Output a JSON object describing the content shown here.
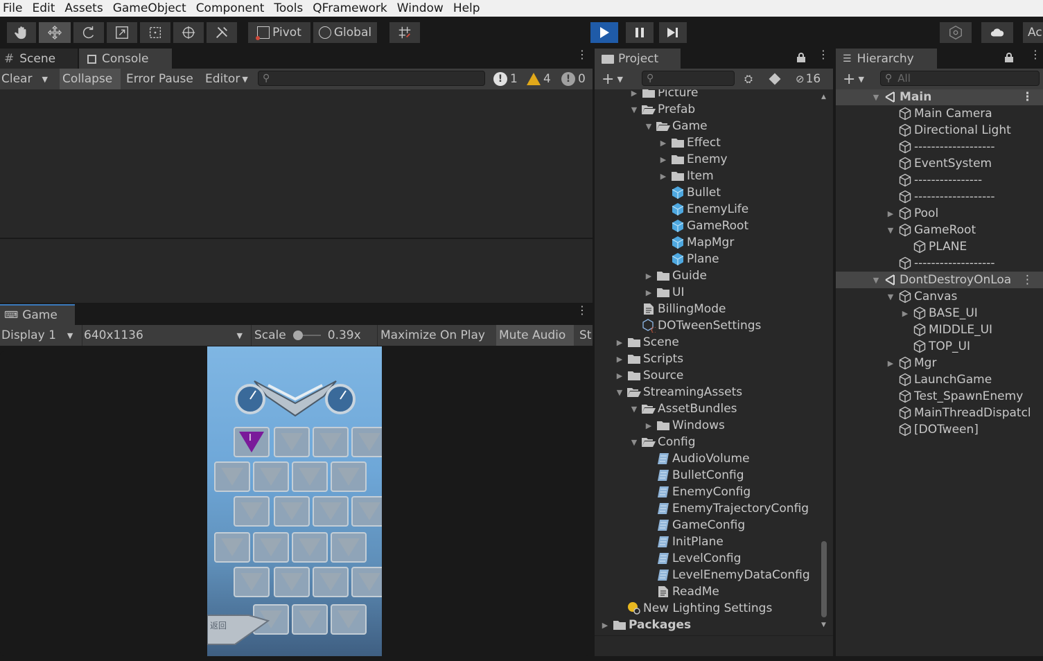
{
  "menu": [
    "File",
    "Edit",
    "Assets",
    "GameObject",
    "Component",
    "Tools",
    "QFramework",
    "Window",
    "Help"
  ],
  "toolbar": {
    "tools": [
      "hand-tool",
      "move-tool",
      "rotate-tool",
      "scale-tool",
      "rect-tool",
      "transform-tool",
      "custom-tool"
    ],
    "pivot_label": "Pivot",
    "global_label": "Global",
    "account_label": "Ac"
  },
  "scene_tab": "Scene",
  "console": {
    "tab": "Console",
    "clear": "Clear",
    "collapse": "Collapse",
    "error_pause": "Error Pause",
    "editor": "Editor",
    "count_error": "1",
    "count_warn": "4",
    "count_info": "0"
  },
  "game": {
    "tab": "Game",
    "display": "Display 1",
    "resolution": "640x1136",
    "scale_label": "Scale",
    "scale_value": "0.39x",
    "maximize": "Maximize On Play",
    "mute": "Mute Audio",
    "stats": "St",
    "back_text": "返回",
    "level_marker": "I"
  },
  "project": {
    "tab": "Project",
    "hidden_count": "16",
    "items": [
      {
        "label": "Picture",
        "indent": 1,
        "arrow": "right",
        "icon": "folder"
      },
      {
        "label": "Prefab",
        "indent": 1,
        "arrow": "down",
        "icon": "folder-open"
      },
      {
        "label": "Game",
        "indent": 2,
        "arrow": "down",
        "icon": "folder-open"
      },
      {
        "label": "Effect",
        "indent": 3,
        "arrow": "right",
        "icon": "folder"
      },
      {
        "label": "Enemy",
        "indent": 3,
        "arrow": "right",
        "icon": "folder"
      },
      {
        "label": "Item",
        "indent": 3,
        "arrow": "right",
        "icon": "folder"
      },
      {
        "label": "Bullet",
        "indent": 3,
        "arrow": "",
        "icon": "prefab"
      },
      {
        "label": "EnemyLife",
        "indent": 3,
        "arrow": "",
        "icon": "prefab"
      },
      {
        "label": "GameRoot",
        "indent": 3,
        "arrow": "",
        "icon": "prefab"
      },
      {
        "label": "MapMgr",
        "indent": 3,
        "arrow": "",
        "icon": "prefab"
      },
      {
        "label": "Plane",
        "indent": 3,
        "arrow": "",
        "icon": "prefab"
      },
      {
        "label": "Guide",
        "indent": 2,
        "arrow": "right",
        "icon": "folder"
      },
      {
        "label": "UI",
        "indent": 2,
        "arrow": "right",
        "icon": "folder"
      },
      {
        "label": "BillingMode",
        "indent": 1,
        "arrow": "",
        "icon": "file"
      },
      {
        "label": "DOTweenSettings",
        "indent": 1,
        "arrow": "",
        "icon": "settings"
      },
      {
        "label": "Scene",
        "indent": 0,
        "arrow": "right",
        "icon": "folder"
      },
      {
        "label": "Scripts",
        "indent": 0,
        "arrow": "right",
        "icon": "folder"
      },
      {
        "label": "Source",
        "indent": 0,
        "arrow": "right",
        "icon": "folder"
      },
      {
        "label": "StreamingAssets",
        "indent": 0,
        "arrow": "down",
        "icon": "folder-open"
      },
      {
        "label": "AssetBundles",
        "indent": 1,
        "arrow": "down",
        "icon": "folder-open"
      },
      {
        "label": "Windows",
        "indent": 2,
        "arrow": "right",
        "icon": "folder"
      },
      {
        "label": "Config",
        "indent": 1,
        "arrow": "down",
        "icon": "folder-open"
      },
      {
        "label": "AudioVolume",
        "indent": 2,
        "arrow": "",
        "icon": "config"
      },
      {
        "label": "BulletConfig",
        "indent": 2,
        "arrow": "",
        "icon": "config"
      },
      {
        "label": "EnemyConfig",
        "indent": 2,
        "arrow": "",
        "icon": "config"
      },
      {
        "label": "EnemyTrajectoryConfig",
        "indent": 2,
        "arrow": "",
        "icon": "config"
      },
      {
        "label": "GameConfig",
        "indent": 2,
        "arrow": "",
        "icon": "config"
      },
      {
        "label": "InitPlane",
        "indent": 2,
        "arrow": "",
        "icon": "config"
      },
      {
        "label": "LevelConfig",
        "indent": 2,
        "arrow": "",
        "icon": "config"
      },
      {
        "label": "LevelEnemyDataConfig",
        "indent": 2,
        "arrow": "",
        "icon": "config"
      },
      {
        "label": "ReadMe",
        "indent": 2,
        "arrow": "",
        "icon": "file"
      },
      {
        "label": "New Lighting Settings",
        "indent": 0,
        "arrow": "",
        "icon": "lighting"
      },
      {
        "label": "Packages",
        "indent": -1,
        "arrow": "right",
        "icon": "folder",
        "bold": true
      }
    ]
  },
  "hierarchy": {
    "tab": "Hierarchy",
    "search_placeholder": "All",
    "items": [
      {
        "label": "Main",
        "indent": 0,
        "arrow": "down",
        "icon": "unity",
        "hi": true,
        "bold": true
      },
      {
        "label": "Main Camera",
        "indent": 1,
        "arrow": "",
        "icon": "cube"
      },
      {
        "label": "Directional Light",
        "indent": 1,
        "arrow": "",
        "icon": "cube"
      },
      {
        "label": "-------------------",
        "indent": 1,
        "arrow": "",
        "icon": "cube"
      },
      {
        "label": "EventSystem",
        "indent": 1,
        "arrow": "",
        "icon": "cube"
      },
      {
        "label": "----------------",
        "indent": 1,
        "arrow": "",
        "icon": "cube"
      },
      {
        "label": "-------------------",
        "indent": 1,
        "arrow": "",
        "icon": "cube"
      },
      {
        "label": "Pool",
        "indent": 1,
        "arrow": "right",
        "icon": "cube"
      },
      {
        "label": "GameRoot",
        "indent": 1,
        "arrow": "down",
        "icon": "cube"
      },
      {
        "label": "PLANE",
        "indent": 2,
        "arrow": "",
        "icon": "cube"
      },
      {
        "label": "-------------------",
        "indent": 1,
        "arrow": "",
        "icon": "cube"
      },
      {
        "label": "DontDestroyOnLoa",
        "indent": 0,
        "arrow": "down",
        "icon": "unity",
        "hi": true
      },
      {
        "label": "Canvas",
        "indent": 1,
        "arrow": "down",
        "icon": "cube"
      },
      {
        "label": "BASE_UI",
        "indent": 2,
        "arrow": "right",
        "icon": "cube"
      },
      {
        "label": "MIDDLE_UI",
        "indent": 2,
        "arrow": "",
        "icon": "cube"
      },
      {
        "label": "TOP_UI",
        "indent": 2,
        "arrow": "",
        "icon": "cube"
      },
      {
        "label": "Mgr",
        "indent": 1,
        "arrow": "right",
        "icon": "cube"
      },
      {
        "label": "LaunchGame",
        "indent": 1,
        "arrow": "",
        "icon": "cube"
      },
      {
        "label": "Test_SpawnEnemy",
        "indent": 1,
        "arrow": "",
        "icon": "cube"
      },
      {
        "label": "MainThreadDispatcl",
        "indent": 1,
        "arrow": "",
        "icon": "cube"
      },
      {
        "label": "[DOTween]",
        "indent": 1,
        "arrow": "",
        "icon": "cube"
      }
    ]
  }
}
